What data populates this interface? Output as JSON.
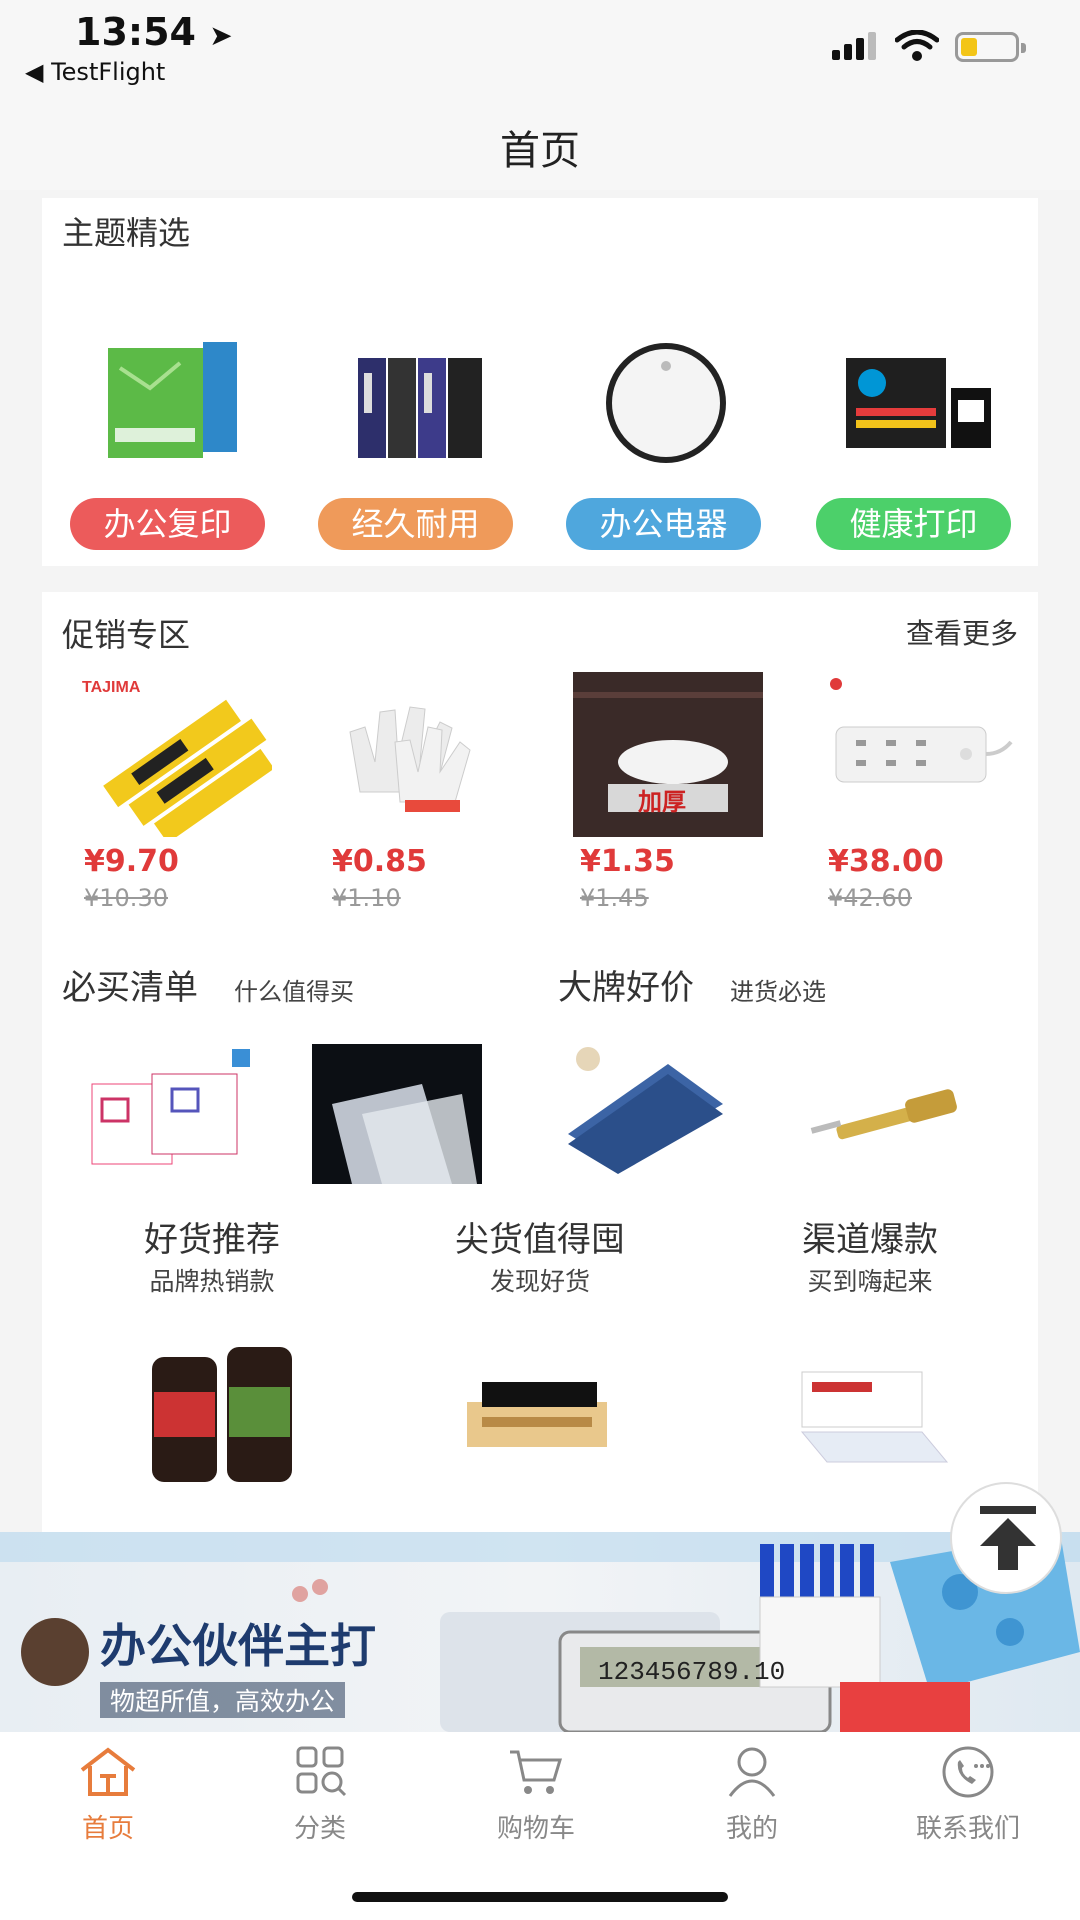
{
  "status_bar": {
    "time": "13:54",
    "back_app": "◀ TestFlight"
  },
  "nav": {
    "title": "首页"
  },
  "theme": {
    "title": "主题精选",
    "items": [
      {
        "label": "办公复印",
        "color": "#ec5b5b"
      },
      {
        "label": "经久耐用",
        "color": "#ef9a5a"
      },
      {
        "label": "办公电器",
        "color": "#4fa7dd"
      },
      {
        "label": "健康打印",
        "color": "#4cd06a"
      }
    ]
  },
  "promo": {
    "title": "促销专区",
    "more": "查看更多",
    "products": [
      {
        "price": "¥9.70",
        "old_price": "¥10.30"
      },
      {
        "price": "¥0.85",
        "old_price": "¥1.10"
      },
      {
        "price": "¥1.35",
        "old_price": "¥1.45"
      },
      {
        "price": "¥38.00",
        "old_price": "¥42.60"
      }
    ]
  },
  "must_buy": {
    "title": "必买清单",
    "subtitle": "什么值得买"
  },
  "big_brand": {
    "title": "大牌好价",
    "subtitle": "进货必选"
  },
  "trio": [
    {
      "title": "好货推荐",
      "subtitle": "品牌热销款"
    },
    {
      "title": "尖货值得囤",
      "subtitle": "发现好货"
    },
    {
      "title": "渠道爆款",
      "subtitle": "买到嗨起来"
    }
  ],
  "banner": {
    "title": "办公伙伴主打",
    "subtitle": "物超所值，高效办公",
    "calculator_display": "123456789.10"
  },
  "tabs": [
    {
      "label": "首页",
      "icon": "home-icon",
      "active": true
    },
    {
      "label": "分类",
      "icon": "grid-icon",
      "active": false
    },
    {
      "label": "购物车",
      "icon": "cart-icon",
      "active": false
    },
    {
      "label": "我的",
      "icon": "user-icon",
      "active": false
    },
    {
      "label": "联系我们",
      "icon": "phone-icon",
      "active": false
    }
  ],
  "colors": {
    "accent": "#e77c3c",
    "price": "#e03a3a"
  }
}
